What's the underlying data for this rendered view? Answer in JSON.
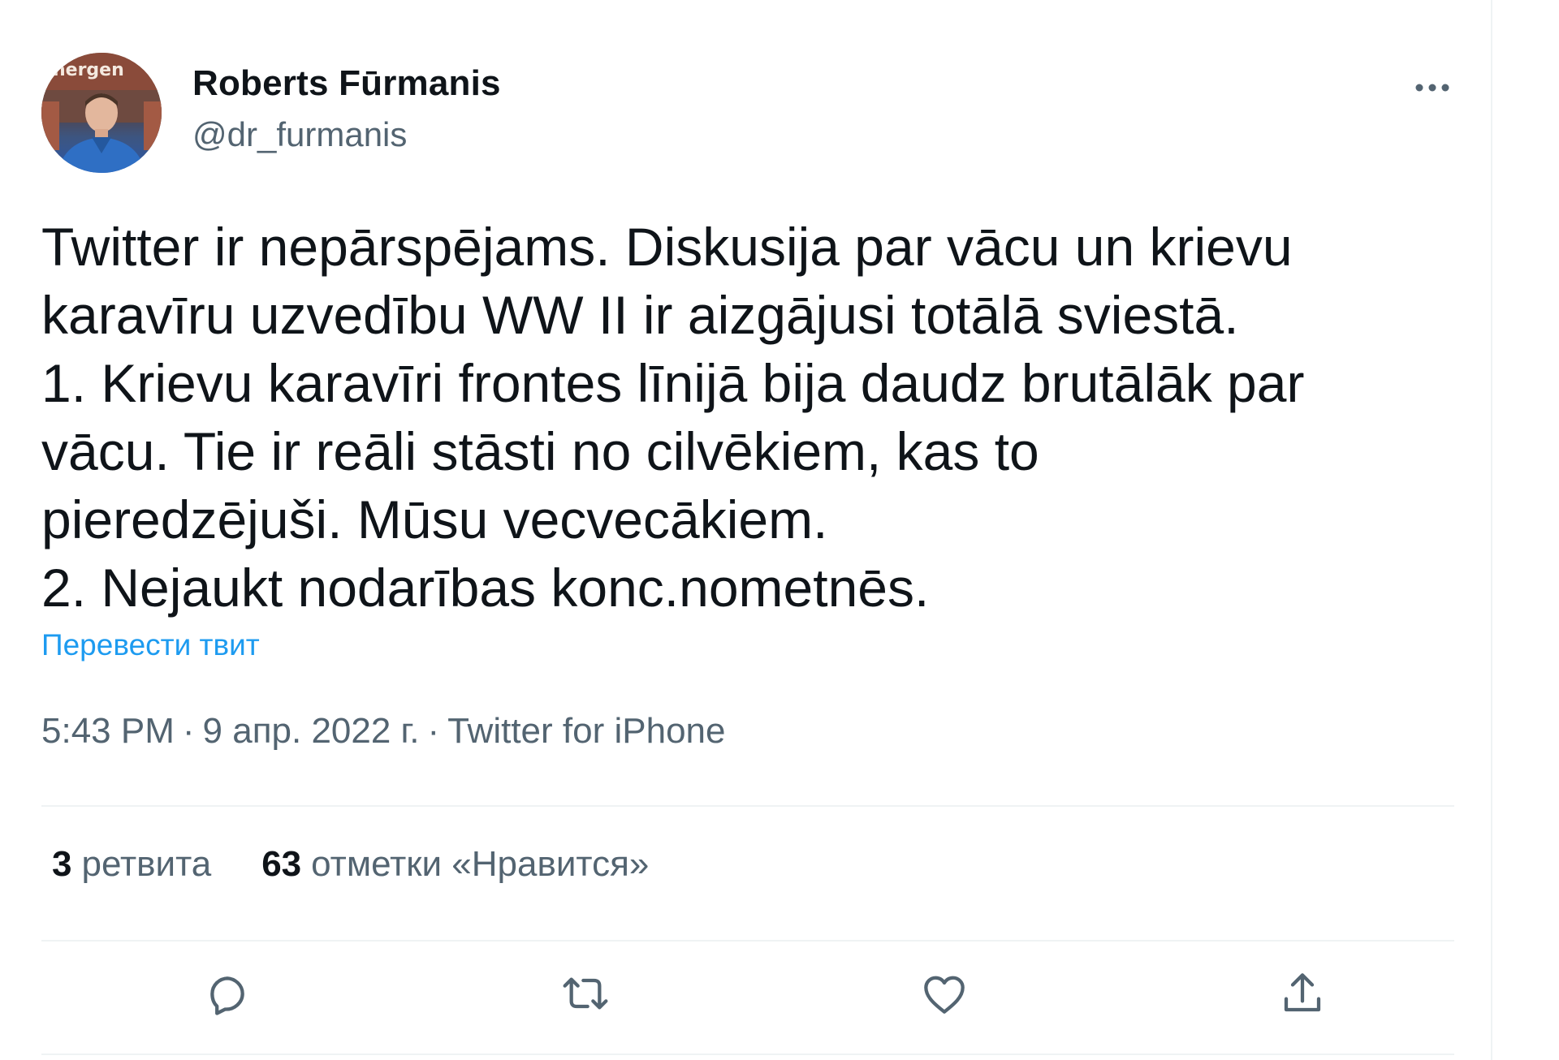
{
  "author": {
    "name": "Roberts Fūrmanis",
    "handle": "@dr_furmanis",
    "avatar_sign_text": "nergen"
  },
  "tweet": {
    "text": "Twitter ir nepārspējams. Diskusija par vācu un krievu\nkaravīru uzvedību WW II ir aizgājusi totālā sviestā.\n1. Krievu karavīri frontes līnijā bija daudz brutālāk par\nvācu. Tie ir reāli stāsti no cilvēkiem, kas to\npieredzējuši. Mūsu vecvecākiem.\n2. Nejaukt nodarības konc.nometnēs.",
    "translate_label": "Перевести твит",
    "time": "5:43 PM",
    "date": "9 апр. 2022 г.",
    "source": "Twitter for iPhone",
    "separator": "·"
  },
  "stats": {
    "retweets_count": "3",
    "retweets_label": "ретвита",
    "likes_count": "63",
    "likes_label": "отметки «Нравится»"
  },
  "icons": {
    "more": "more-horizontal-icon",
    "reply": "reply-icon",
    "retweet": "retweet-icon",
    "like": "heart-icon",
    "share": "share-icon"
  },
  "colors": {
    "text": "#0f1419",
    "secondary": "#536471",
    "link": "#1d9bf0",
    "divider": "#eff3f4"
  }
}
